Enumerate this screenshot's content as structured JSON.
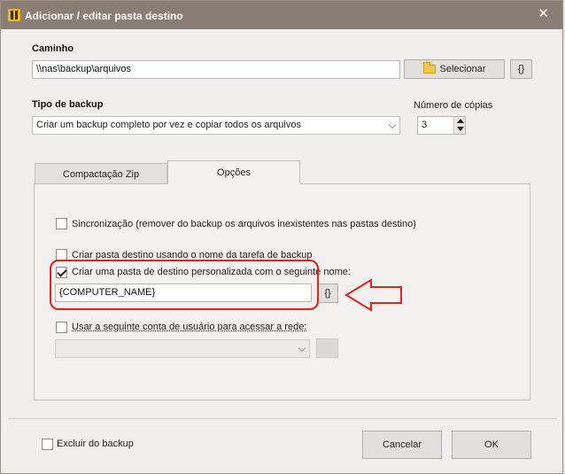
{
  "window": {
    "title": "Adicionar / editar pasta destino"
  },
  "path": {
    "label": "Caminho",
    "value": "\\\\nas\\backup\\arquivos",
    "select_label": "Selecionar",
    "macro_label": "{}"
  },
  "backup_type": {
    "label": "Tipo de backup",
    "selected": "Criar um backup completo por vez e copiar todos os arquivos"
  },
  "copies": {
    "label": "Número de cópias",
    "value": "3"
  },
  "tabs": [
    {
      "label": "Compactação Zip",
      "active": false
    },
    {
      "label": "Opções",
      "active": true
    }
  ],
  "options": {
    "sync": {
      "label": "Sincronização (remover do backup os arquivos inexistentes nas pastas destino)",
      "checked": false
    },
    "task_name_folder": {
      "label": "Criar pasta destino usando o nome da tarefa de backup",
      "checked": false
    },
    "custom_folder": {
      "label": "Criar uma pasta de destino personalizada com o seguinte nome:",
      "checked": true,
      "value": "{COMPUTER_NAME}",
      "macro_label": "{}"
    },
    "user_account": {
      "label": "Usar a seguinte conta de usuário para acessar a rede:",
      "checked": false,
      "selected": ""
    }
  },
  "footer": {
    "exclude": {
      "label": "Excluir do backup",
      "checked": false
    },
    "cancel_label": "Cancelar",
    "ok_label": "OK"
  },
  "colors": {
    "titlebar": "#8a7e74",
    "annotation": "#e0231c"
  }
}
